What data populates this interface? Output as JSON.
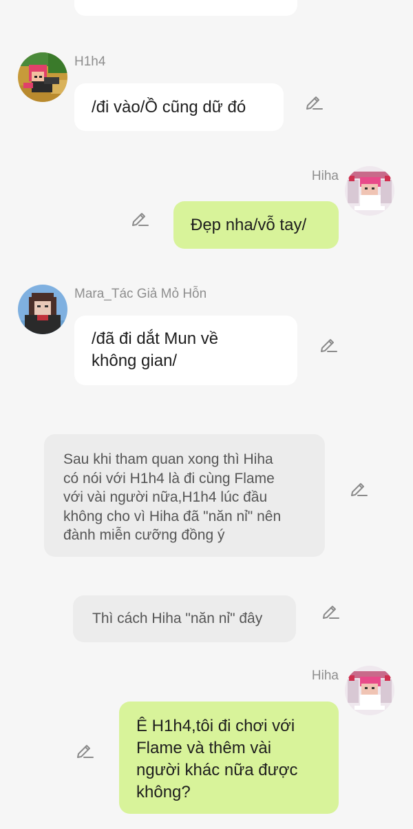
{
  "colors": {
    "background": "#f6f6f6",
    "bubble_received": "#ffffff",
    "bubble_sent": "#d8f39a",
    "bubble_narration": "#ececec",
    "name_text": "#8e8e8e",
    "icon": "#8a8a8a"
  },
  "icons": {
    "edit": "pencil-edit-icon"
  },
  "messages": [
    {
      "id": "m0",
      "type": "received",
      "sender": "",
      "text": ""
    },
    {
      "id": "m1",
      "type": "received",
      "sender": "H1h4",
      "text": "/đi vào/Ồ cũng dữ đó"
    },
    {
      "id": "m2",
      "type": "sent",
      "sender": "Hiha",
      "text": "Đẹp nha/vỗ tay/"
    },
    {
      "id": "m3",
      "type": "received",
      "sender": "Mara_Tác Giả Mỏ Hỗn",
      "text_lines": [
        "/đã đi dắt Mun về",
        "không gian/"
      ]
    },
    {
      "id": "m4",
      "type": "narration",
      "text_lines": [
        "Sau khi tham quan xong thì Hiha",
        "có nói với H1h4 là đi cùng Flame",
        "với vài người nữa,H1h4 lúc đầu",
        "không cho vì Hiha đã \"năn nỉ\" nên",
        "đành miễn cưỡng đồng ý"
      ]
    },
    {
      "id": "m5",
      "type": "narration",
      "text": "Thì cách Hiha \"năn nỉ\" đây"
    },
    {
      "id": "m6",
      "type": "sent",
      "sender": "Hiha",
      "text_lines": [
        "Ê H1h4,tôi đi chơi với",
        "Flame và thêm vài",
        "người khác nữa được",
        "không?"
      ]
    }
  ],
  "avatar_labels": {
    "hiha": "Hiha"
  }
}
